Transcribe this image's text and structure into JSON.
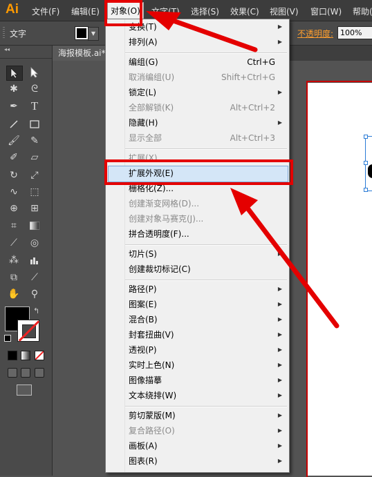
{
  "app": {
    "logo": "Ai"
  },
  "menubar": {
    "items": [
      "文件(F)",
      "编辑(E)",
      "对象(O)",
      "文字(T)",
      "选择(S)",
      "效果(C)",
      "视图(V)",
      "窗口(W)",
      "帮助("
    ]
  },
  "control_bar": {
    "label": "文字",
    "opacity_label": "不透明度:",
    "opacity_value": "100%"
  },
  "document": {
    "tab_title": "海报模板.ai*"
  },
  "object_menu": {
    "items": [
      {
        "label": "变换(T)",
        "shortcut": "",
        "submenu": true,
        "disabled": false
      },
      {
        "label": "排列(A)",
        "shortcut": "",
        "submenu": true,
        "disabled": false
      },
      {
        "label": "编组(G)",
        "shortcut": "Ctrl+G",
        "submenu": false,
        "disabled": false
      },
      {
        "label": "取消编组(U)",
        "shortcut": "Shift+Ctrl+G",
        "submenu": false,
        "disabled": true
      },
      {
        "label": "锁定(L)",
        "shortcut": "",
        "submenu": true,
        "disabled": false
      },
      {
        "label": "全部解锁(K)",
        "shortcut": "Alt+Ctrl+2",
        "submenu": false,
        "disabled": true
      },
      {
        "label": "隐藏(H)",
        "shortcut": "",
        "submenu": true,
        "disabled": false
      },
      {
        "label": "显示全部",
        "shortcut": "Alt+Ctrl+3",
        "submenu": false,
        "disabled": true
      },
      {
        "label": "扩展(X)...",
        "shortcut": "",
        "submenu": false,
        "disabled": true
      },
      {
        "label": "扩展外观(E)",
        "shortcut": "",
        "submenu": false,
        "disabled": false
      },
      {
        "label": "栅格化(Z)...",
        "shortcut": "",
        "submenu": false,
        "disabled": false
      },
      {
        "label": "创建渐变网格(D)...",
        "shortcut": "",
        "submenu": false,
        "disabled": true
      },
      {
        "label": "创建对象马赛克(J)...",
        "shortcut": "",
        "submenu": false,
        "disabled": true
      },
      {
        "label": "拼合透明度(F)...",
        "shortcut": "",
        "submenu": false,
        "disabled": false
      },
      {
        "label": "切片(S)",
        "shortcut": "",
        "submenu": true,
        "disabled": false
      },
      {
        "label": "创建裁切标记(C)",
        "shortcut": "",
        "submenu": false,
        "disabled": false
      },
      {
        "label": "路径(P)",
        "shortcut": "",
        "submenu": true,
        "disabled": false
      },
      {
        "label": "图案(E)",
        "shortcut": "",
        "submenu": true,
        "disabled": false
      },
      {
        "label": "混合(B)",
        "shortcut": "",
        "submenu": true,
        "disabled": false
      },
      {
        "label": "封套扭曲(V)",
        "shortcut": "",
        "submenu": true,
        "disabled": false
      },
      {
        "label": "透视(P)",
        "shortcut": "",
        "submenu": true,
        "disabled": false
      },
      {
        "label": "实时上色(N)",
        "shortcut": "",
        "submenu": true,
        "disabled": false
      },
      {
        "label": "图像描摹",
        "shortcut": "",
        "submenu": true,
        "disabled": false
      },
      {
        "label": "文本绕排(W)",
        "shortcut": "",
        "submenu": true,
        "disabled": false
      },
      {
        "label": "剪切蒙版(M)",
        "shortcut": "",
        "submenu": true,
        "disabled": false
      },
      {
        "label": "复合路径(O)",
        "shortcut": "",
        "submenu": true,
        "disabled": true
      },
      {
        "label": "画板(A)",
        "shortcut": "",
        "submenu": true,
        "disabled": false
      },
      {
        "label": "图表(R)",
        "shortcut": "",
        "submenu": true,
        "disabled": false
      }
    ]
  },
  "tools": [
    "selection-tool",
    "direct-selection-tool",
    "magic-wand-tool",
    "lasso-tool",
    "pen-tool",
    "type-tool",
    "line-tool",
    "rectangle-tool",
    "paintbrush-tool",
    "pencil-tool",
    "blob-brush-tool",
    "eraser-tool",
    "rotate-tool",
    "scale-tool",
    "warp-tool",
    "free-transform-tool",
    "shape-builder-tool",
    "perspective-grid-tool",
    "mesh-tool",
    "gradient-tool",
    "eyedropper-tool",
    "blend-tool",
    "symbol-sprayer-tool",
    "column-graph-tool",
    "artboard-tool",
    "slice-tool",
    "hand-tool",
    "zoom-tool"
  ],
  "colors": {
    "annotation_red": "#e40000",
    "highlight_blue": "#d4e6f7",
    "accent_orange": "#ff9a00"
  }
}
